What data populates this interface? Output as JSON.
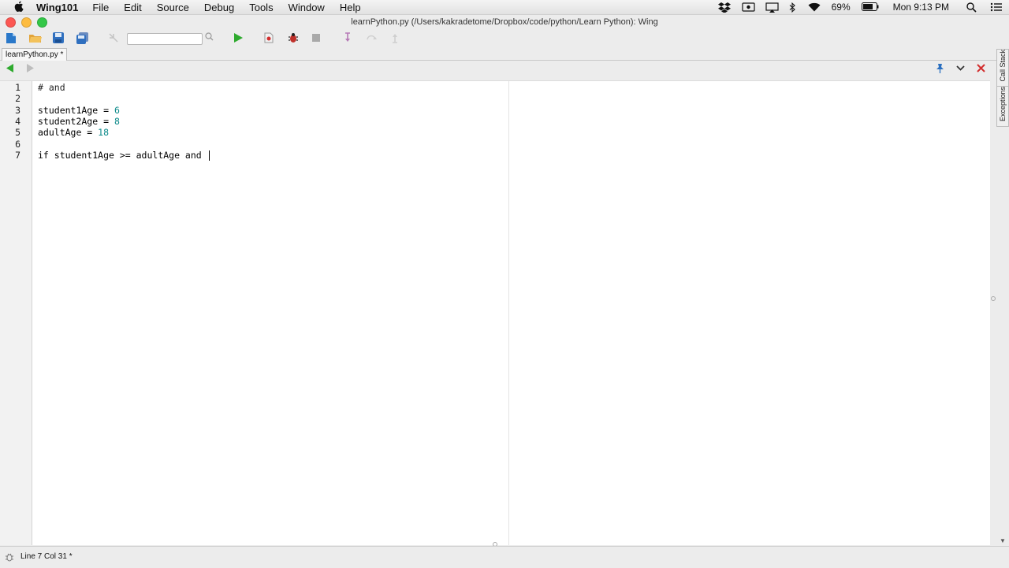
{
  "menubar": {
    "app_name": "Wing101",
    "items": [
      "File",
      "Edit",
      "Source",
      "Debug",
      "Tools",
      "Window",
      "Help"
    ],
    "battery": "69%",
    "clock": "Mon 9:13 PM"
  },
  "window": {
    "title": "learnPython.py (/Users/kakradetome/Dropbox/code/python/Learn Python): Wing"
  },
  "editor": {
    "tab_label": "learnPython.py *",
    "lines": [
      {
        "n": "1",
        "text": "# and"
      },
      {
        "n": "2",
        "text": ""
      },
      {
        "n": "3",
        "code": "student1Age = ",
        "value": "6"
      },
      {
        "n": "4",
        "code": "student2Age = ",
        "value": "8"
      },
      {
        "n": "5",
        "code": "adultAge = ",
        "value": "18"
      },
      {
        "n": "6",
        "text": ""
      },
      {
        "n": "7",
        "text": "if student1Age >= adultAge and "
      }
    ]
  },
  "side_tabs": {
    "call_stack": "Call Stack",
    "exceptions": "Exceptions"
  },
  "statusbar": {
    "position": "Line 7 Col 31 *"
  },
  "colors": {
    "number": "#0c8a8a",
    "run_green": "#2eaa2e",
    "close_red": "#d22d2d"
  }
}
